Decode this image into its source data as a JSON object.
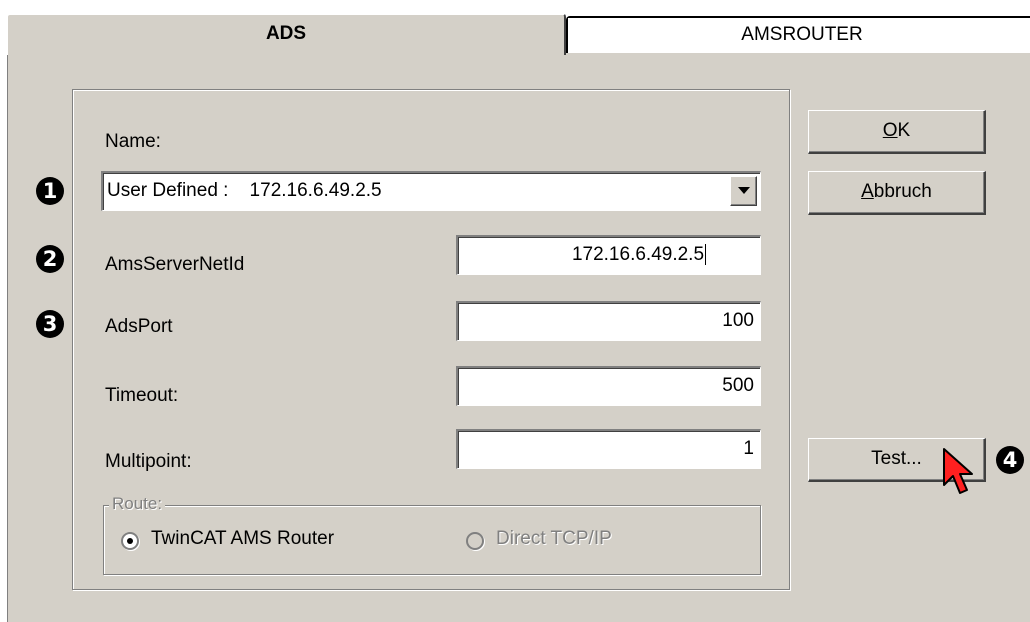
{
  "tabs": [
    {
      "label": "ADS",
      "active": true
    },
    {
      "label": "AMSROUTER",
      "active": false
    }
  ],
  "form": {
    "name_label": "Name:",
    "name_value": "User Defined :    172.16.6.49.2.5",
    "ams_server_netid_label": "AmsServerNetId",
    "ams_server_netid_value": "172.16.6.49.2.5",
    "ads_port_label": "AdsPort",
    "ads_port_value": "100",
    "timeout_label": "Timeout:",
    "timeout_value": "500",
    "multipoint_label": "Multipoint:",
    "multipoint_value": "1"
  },
  "route": {
    "legend": "Route:",
    "options": [
      {
        "label": "TwinCAT AMS Router",
        "selected": true,
        "enabled": true
      },
      {
        "label": "Direct TCP/IP",
        "selected": false,
        "enabled": false
      }
    ]
  },
  "buttons": {
    "ok": "OK",
    "cancel": "Abbruch",
    "test": "Test..."
  },
  "markers": [
    "1",
    "2",
    "3",
    "4"
  ],
  "icons": {
    "dropdown": "chevron-down-icon",
    "cursor": "mouse-pointer-icon"
  }
}
